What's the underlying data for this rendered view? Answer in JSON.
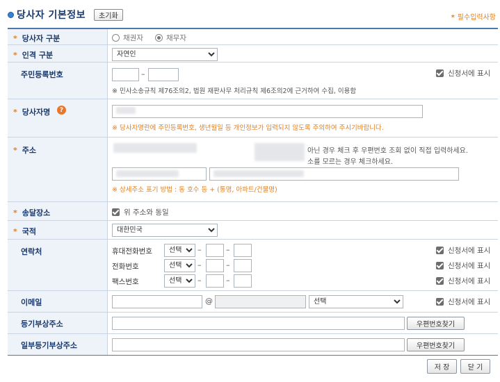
{
  "header": {
    "title": "당사자 기본정보",
    "reset_label": "초기화",
    "required_note": "필수입력사항",
    "asterisk": "*"
  },
  "rows": {
    "party_type": {
      "label": "당사자 구분",
      "options": [
        "채권자",
        "채무자"
      ],
      "selected": "채무자"
    },
    "person_type": {
      "label": "인격 구분",
      "value": "자연인"
    },
    "resident_no": {
      "label": "주민등록번호",
      "dash": "–",
      "show_label": "신청서에 표시",
      "note": "※ 민사소송규칙 제76조의2, 법원 재판사무 처리규칙 제6조의2에 근거하여 수집, 이용함"
    },
    "party_name": {
      "label": "당사자명",
      "help": "?",
      "note": "※ 당사자명란에 주민등록번호, 생년월일 등 개인정보가 입력되지 않도록 주의하여 주시기바랍니다."
    },
    "address": {
      "label": "주소",
      "note1": "아닌 경우 체크 후 우편번호 조회 없이 직접 입력하세요.",
      "note2": "소를 모르는 경우 체크하세요.",
      "note3": "※ 상세주소 표기 방법 : 동 호수 등 + (통명, 아파트/건물명)"
    },
    "delivery": {
      "label": "송달장소",
      "same_label": "위 주소와 동일"
    },
    "nationality": {
      "label": "국적",
      "value": "대한민국"
    },
    "contact": {
      "label": "연락처",
      "dash": "–",
      "select_label": "선택",
      "show_label": "신청서에 표시",
      "items": [
        "휴대전화번호",
        "전화번호",
        "팩스번호"
      ]
    },
    "email": {
      "label": "이메일",
      "at": "@",
      "domain_select": "선택",
      "show_label": "신청서에 표시"
    },
    "reg_addr": {
      "label": "등기부상주소",
      "btn": "우편번호찾기"
    },
    "partial_reg_addr": {
      "label": "일부등기부상주소",
      "btn": "우편번호찾기"
    }
  },
  "footer": {
    "save": "저 장",
    "close": "닫 기"
  }
}
